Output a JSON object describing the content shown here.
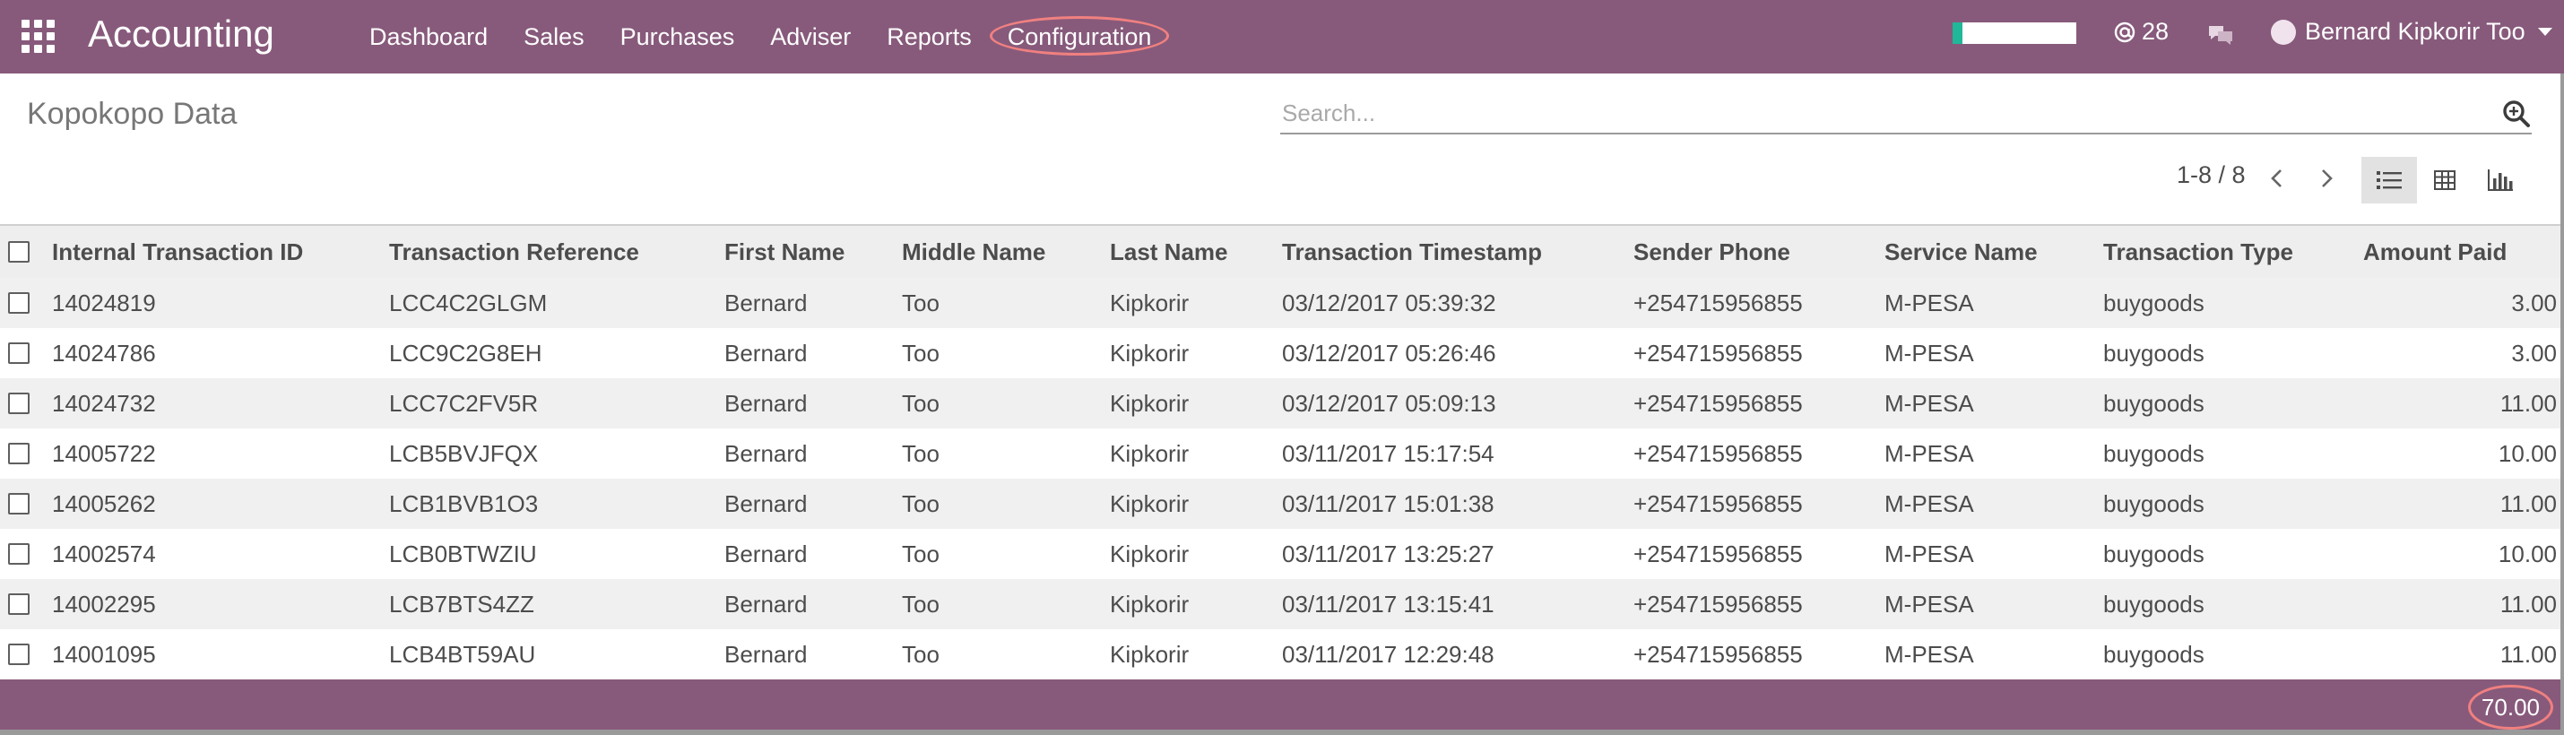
{
  "app": {
    "name": "Accounting",
    "menu": [
      "Dashboard",
      "Sales",
      "Purchases",
      "Adviser",
      "Reports",
      "Configuration"
    ],
    "highlighted_menu": "Configuration",
    "progress_fraction": 0.08,
    "mentions_count": "28",
    "user_name": "Bernard Kipkorir Too"
  },
  "colors": {
    "brand": "#875a7b",
    "progress": "#21b799",
    "annotation": "#f08080"
  },
  "page": {
    "title": "Kopokopo Data",
    "search_placeholder": "Search...",
    "pager_text": "1-8 / 8",
    "active_view": "list"
  },
  "table": {
    "columns": [
      "Internal Transaction ID",
      "Transaction Reference",
      "First Name",
      "Middle Name",
      "Last Name",
      "Transaction Timestamp",
      "Sender Phone",
      "Service Name",
      "Transaction Type",
      "Amount Paid"
    ],
    "rows": [
      [
        "14024819",
        "LCC4C2GLGM",
        "Bernard",
        "Too",
        "Kipkorir",
        "03/12/2017 05:39:32",
        "+254715956855",
        "M-PESA",
        "buygoods",
        "3.00"
      ],
      [
        "14024786",
        "LCC9C2G8EH",
        "Bernard",
        "Too",
        "Kipkorir",
        "03/12/2017 05:26:46",
        "+254715956855",
        "M-PESA",
        "buygoods",
        "3.00"
      ],
      [
        "14024732",
        "LCC7C2FV5R",
        "Bernard",
        "Too",
        "Kipkorir",
        "03/12/2017 05:09:13",
        "+254715956855",
        "M-PESA",
        "buygoods",
        "11.00"
      ],
      [
        "14005722",
        "LCB5BVJFQX",
        "Bernard",
        "Too",
        "Kipkorir",
        "03/11/2017 15:17:54",
        "+254715956855",
        "M-PESA",
        "buygoods",
        "10.00"
      ],
      [
        "14005262",
        "LCB1BVB1O3",
        "Bernard",
        "Too",
        "Kipkorir",
        "03/11/2017 15:01:38",
        "+254715956855",
        "M-PESA",
        "buygoods",
        "11.00"
      ],
      [
        "14002574",
        "LCB0BTWZIU",
        "Bernard",
        "Too",
        "Kipkorir",
        "03/11/2017 13:25:27",
        "+254715956855",
        "M-PESA",
        "buygoods",
        "10.00"
      ],
      [
        "14002295",
        "LCB7BTS4ZZ",
        "Bernard",
        "Too",
        "Kipkorir",
        "03/11/2017 13:15:41",
        "+254715956855",
        "M-PESA",
        "buygoods",
        "11.00"
      ],
      [
        "14001095",
        "LCB4BT59AU",
        "Bernard",
        "Too",
        "Kipkorir",
        "03/11/2017 12:29:48",
        "+254715956855",
        "M-PESA",
        "buygoods",
        "11.00"
      ]
    ],
    "total": "70.00"
  }
}
